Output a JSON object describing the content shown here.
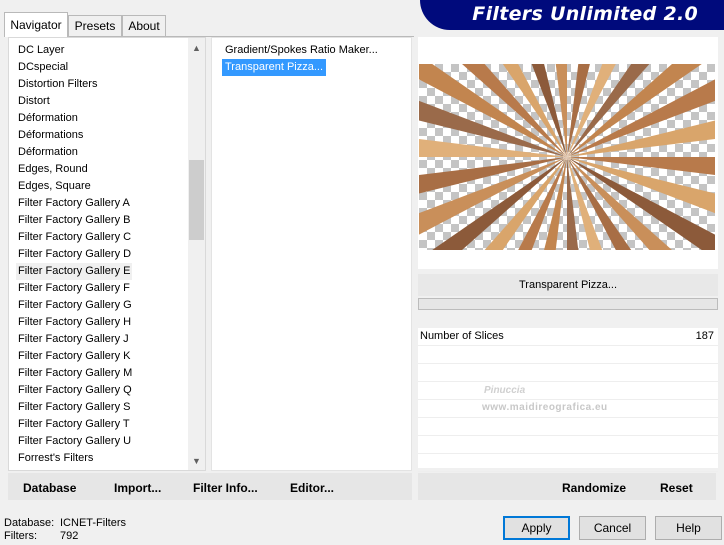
{
  "tabs": [
    "Navigator",
    "Presets",
    "About"
  ],
  "app_title": "Filters Unlimited 2.0",
  "categories": [
    "DC Layer",
    "DCspecial",
    "Distortion Filters",
    "Distort",
    "Déformation",
    "Déformations",
    "Déformation",
    "Edges, Round",
    "Edges, Square",
    "Filter Factory Gallery A",
    "Filter Factory Gallery B",
    "Filter Factory Gallery C",
    "Filter Factory Gallery D",
    "Filter Factory Gallery E",
    "Filter Factory Gallery F",
    "Filter Factory Gallery G",
    "Filter Factory Gallery H",
    "Filter Factory Gallery J",
    "Filter Factory Gallery K",
    "Filter Factory Gallery M",
    "Filter Factory Gallery Q",
    "Filter Factory Gallery S",
    "Filter Factory Gallery T",
    "Filter Factory Gallery U",
    "Forrest's Filters"
  ],
  "selected_category": "Filter Factory Gallery E",
  "filters": [
    "Gradient/Spokes Ratio Maker...",
    "Transparent Pizza..."
  ],
  "selected_filter": "Transparent Pizza...",
  "filter_name": "Transparent Pizza...",
  "params": [
    {
      "label": "Number of Slices",
      "value": "187"
    }
  ],
  "watermark": {
    "name": "Pinuccia",
    "url": "www.maidireografica.eu"
  },
  "left_buttons": [
    "Database",
    "Import...",
    "Filter Info...",
    "Editor..."
  ],
  "right_buttons": [
    "Randomize",
    "Reset"
  ],
  "info": {
    "database_label": "Database:",
    "database_value": "ICNET-Filters",
    "filters_label": "Filters:",
    "filters_value": "792"
  },
  "dialog_buttons": {
    "apply": "Apply",
    "cancel": "Cancel",
    "help": "Help"
  },
  "icons": {
    "scroll_up": "chevron-up-icon",
    "scroll_down": "chevron-down-icon"
  }
}
